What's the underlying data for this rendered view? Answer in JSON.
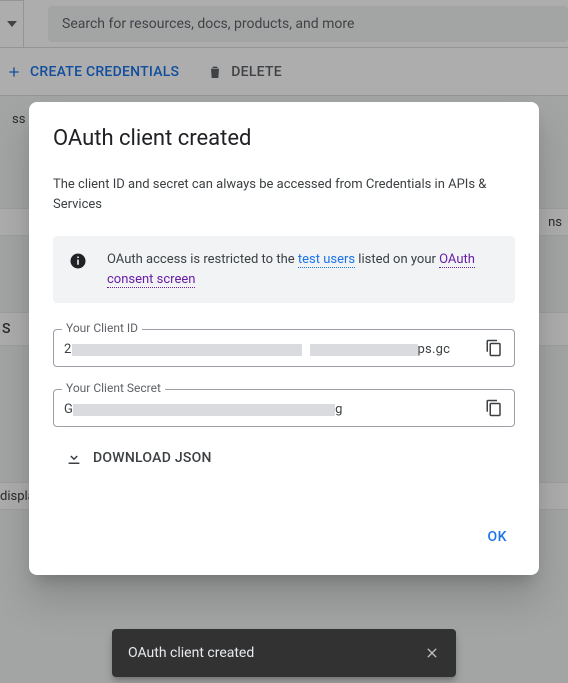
{
  "header": {
    "search_placeholder": "Search for resources, docs, products, and more"
  },
  "actionbar": {
    "create_label": "CREATE CREDENTIALS",
    "delete_label": "DELETE"
  },
  "bg": {
    "snippet1": "ss you",
    "snippet2": "ns",
    "snippet3": "S",
    "snippet4": "displa"
  },
  "dialog": {
    "title": "OAuth client created",
    "subtitle": "The client ID and secret can always be accessed from Credentials in APIs & Services",
    "info_pre": "OAuth access is restricted to the ",
    "info_link1": "test users",
    "info_mid": " listed on your ",
    "info_link2": "OAuth consent screen",
    "client_id": {
      "label": "Your Client ID",
      "prefix": "2",
      "suffix": "ps.gc"
    },
    "client_secret": {
      "label": "Your Client Secret",
      "prefix": "G",
      "suffix": "g"
    },
    "download": "DOWNLOAD JSON",
    "ok": "OK"
  },
  "toast": {
    "message": "OAuth client created"
  }
}
